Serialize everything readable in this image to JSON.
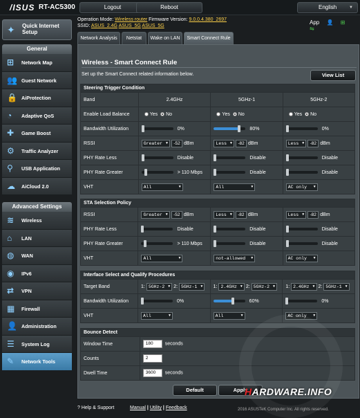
{
  "header": {
    "logo": "/ISUS",
    "model": "RT-AC5300",
    "logout": "Logout",
    "reboot": "Reboot",
    "language": "English"
  },
  "info": {
    "op_mode_label": "Operation Mode:",
    "op_mode": "Wireless router",
    "firmware_label": "Firmware Version:",
    "firmware": "9.0.0.4.380_2697",
    "ssid_label": "SSID:",
    "ssid1": "ASUS_2.4G",
    "ssid2": "ASUS_5G",
    "ssid3": "ASUS_5G",
    "app": "App"
  },
  "sidebar": {
    "qis": "Quick Internet Setup",
    "general_title": "General",
    "general": [
      "Network Map",
      "Guest Network",
      "AiProtection",
      "Adaptive QoS",
      "Game Boost",
      "Traffic Analyzer",
      "USB Application",
      "AiCloud 2.0"
    ],
    "advanced_title": "Advanced Settings",
    "advanced": [
      "Wireless",
      "LAN",
      "WAN",
      "IPv6",
      "VPN",
      "Firewall",
      "Administration",
      "System Log",
      "Network Tools"
    ]
  },
  "tabs": [
    "Network Analysis",
    "Netstat",
    "Wake on LAN",
    "Smart Connect Rule"
  ],
  "page": {
    "title": "Wireless - Smart Connect Rule",
    "desc": "Set up the Smart Connect related information below.",
    "view_list": "View List"
  },
  "steering": {
    "title": "Steering Trigger Condition",
    "band_label": "Band",
    "bands": [
      "2.4GHz",
      "5GHz-1",
      "5GHz-2"
    ],
    "load_balance_label": "Enable Load Balance",
    "yes": "Yes",
    "no": "No",
    "bw_label": "Bandwidth Utilization",
    "bw": [
      "0%",
      "80%",
      "0%"
    ],
    "bw_value": [
      0,
      80,
      0
    ],
    "rssi_label": "RSSI",
    "rssi_op": [
      "Greater",
      "Less",
      "Less"
    ],
    "rssi_val": [
      "-52",
      "-82",
      "-82"
    ],
    "dbm": "dBm",
    "phy_less_label": "PHY Rate Less",
    "phy_less": [
      "Disable",
      "Disable",
      "Disable"
    ],
    "phy_greater_label": "PHY Rate Greater",
    "phy_greater": [
      "> 110 Mbps",
      "Disable",
      "Disable"
    ],
    "vht_label": "VHT",
    "vht": [
      "All",
      "All",
      "AC only"
    ]
  },
  "sta": {
    "title": "STA Selection Policy",
    "rssi_label": "RSSI",
    "rssi_op": [
      "Greater",
      "Less",
      "Less"
    ],
    "rssi_val": [
      "-52",
      "-82",
      "-82"
    ],
    "phy_less_label": "PHY Rate Less",
    "phy_less": [
      "Disable",
      "Disable",
      "Disable"
    ],
    "phy_greater_label": "PHY Rate Greater",
    "phy_greater": [
      "> 110 Mbps",
      "Disable",
      "Disable"
    ],
    "vht_label": "VHT",
    "vht": [
      "All",
      "not-allowed",
      "AC only"
    ]
  },
  "iface": {
    "title": "Interface Select and Qualify Procedures",
    "target_label": "Target Band",
    "targets": [
      [
        "5GHz-2",
        "5GHz-1"
      ],
      [
        "2.4GHz",
        "5GHz-2"
      ],
      [
        "2.4GHz",
        "5GHz-1"
      ]
    ],
    "n1": "1:",
    "n2": "2:",
    "bw_label": "Bandwidth Utilization",
    "bw": [
      "0%",
      "60%",
      "0%"
    ],
    "bw_value": [
      0,
      60,
      0
    ],
    "vht_label": "VHT",
    "vht": [
      "All",
      "All",
      "AC only"
    ]
  },
  "bounce": {
    "title": "Bounce Detect",
    "window_label": "Window Time",
    "window": "180",
    "seconds": "seconds",
    "counts_label": "Counts",
    "counts": "2",
    "dwell_label": "Dwell Time",
    "dwell": "3600"
  },
  "buttons": {
    "default": "Default",
    "apply": "Apply"
  },
  "footer": {
    "help": "Help & Support",
    "manual": "Manual",
    "utility": "Utility",
    "feedback": "Feedback",
    "sep": "|",
    "copyright": "2016 ASUSTeK Computer Inc. All rights reserved."
  },
  "watermark": {
    "a": "H",
    "b": "ARDWARE.INFO"
  }
}
